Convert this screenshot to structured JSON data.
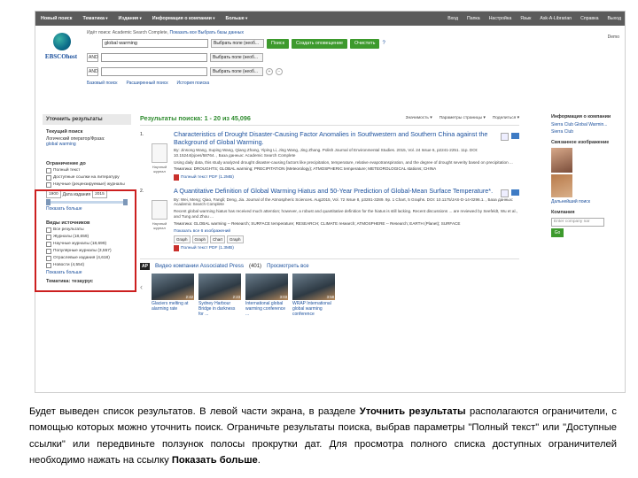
{
  "topbar": {
    "items": [
      "Новый поиск",
      "Тематика",
      "Издания",
      "Информация о компании",
      "Больше"
    ],
    "right_items": [
      "Вход",
      "Папка",
      "Настройка",
      "Язык",
      "Ask-A-Librarian",
      "Справка",
      "Выход"
    ]
  },
  "logo": {
    "text": "EBSCOhost"
  },
  "search": {
    "crumb_label": "Идёт поиск: Academic Search Complete",
    "crumb_link1": "Показать все",
    "crumb_link2": "Выбрать базы данных",
    "rows": [
      {
        "op": "",
        "value": "global warming",
        "field": "Выбрать поле (необ..."
      },
      {
        "op": "AND",
        "value": "",
        "field": "Выбрать поле (необ..."
      },
      {
        "op": "AND",
        "value": "",
        "field": "Выбрать поле (необ..."
      }
    ],
    "btn_search": "Поиск",
    "btn_alert": "Создать оповещение",
    "btn_clear": "Очистить",
    "link_basic": "Базовый поиск",
    "link_advanced": "Расширенный поиск",
    "link_history": "История поиска"
  },
  "demo": "Demo",
  "sidebar": {
    "refine_title": "Уточнить результаты",
    "current_title": "Текущий поиск",
    "bool_label": "Логический оператор/Фраза:",
    "bool_value": "global warming",
    "limit_title": "Ограничение до",
    "limits": [
      "Полный текст",
      "Доступные ссылки на литературу",
      "Научные (рецензируемые) журналы"
    ],
    "date_from": "1900",
    "date_label": "Дата издания",
    "date_to": "2015",
    "show_more": "Показать больше",
    "source_title": "Виды источников",
    "sources": [
      "Все результаты",
      "Журналы (18,659)",
      "Научные журналы (18,699)",
      "Популярные журналы (3,557)",
      "Отраслевые издания (4,618)",
      "Новости (4,554)"
    ],
    "show_more2": "Показать больше",
    "subject_title": "Тематика: тезаурус"
  },
  "results": {
    "header": "Результаты поиска: 1 - 20 из 45,096",
    "sort": "Значимость ▾",
    "page_opts": "Параметры страницы ▾",
    "share": "Поделиться ▾",
    "items": [
      {
        "num": "1.",
        "title": "Characteristics of Drought Disaster-Causing Factor Anomalies in Southwestern and Southern China against the Background of Global Warming.",
        "meta": "By: Jinsong Wang, Suping Wang, Qiang Zhang, Yiping Li, Jing Wang, Jing Zhang. Polish Journal of Environmental Studies. 2015, Vol. 24 Issue 6, p2241-2251. 11p. DOI: 10.15244/pjoes/58764. , База данных: Academic Search Complete",
        "abstract": "Using daily data, this study analyzed drought disaster-causing factors like precipitation, temperature, relative evapotranspiration, and the degree of drought severity based on precipitation ...",
        "subjects": "Тематика: DROUGHTS; GLOBAL warming; PRECIPITATION (Meteorology); ATMOSPHERIC temperature; METEOROLOGICAL stations; CHINA",
        "thumb_label": "Научный журнал",
        "pdf": "Полный текст PDF (1.2MB)"
      },
      {
        "num": "2.",
        "title": "A Quantitative Definition of Global Warming Hiatus and 50-Year Prediction of Global-Mean Surface Temperature*.",
        "meta": "By: Wei, Meng; Qiao, Fangli; Deng, Jia. Journal of the Atmospheric Sciences. Aug2015, Vol. 72 Issue 8, p3281-3289. 9p. 1 Chart, 5 Graphs. DOI: 10.1175/JAS-D-14-0296.1. , База данных: Academic Search Complete",
        "abstract": "Recent global warming hiatus has received much attention; however, a robust and quantitative definition for the hiatus is still lacking. Recent discussions ... are reviewed by Seefeldt, Wu et al., and Tung and Zhou ...",
        "subjects": "Тематика: GLOBAL warming -- Research; SURFACE temperature; RESEARCH; CLIMATE research; ATMOSPHERE -- Research; EARTH (Planet); SURFACE",
        "thumb_label": "Научный журнал",
        "images_label": "Показать все 6 изображений",
        "images": [
          "Graph",
          "Graph",
          "Chart",
          "Graph"
        ],
        "pdf": "Полный текст PDF (1.3MB)"
      }
    ]
  },
  "video": {
    "badge": "AP",
    "title": "Видео компании Associated Press",
    "count": "(401)",
    "view_all": "Просмотреть все",
    "items": [
      {
        "caption": "Glaciers melting at alarming rate",
        "duration": "2:42"
      },
      {
        "caption": "Sydney Harbour Bridge in darkness for ...",
        "duration": "2:23"
      },
      {
        "caption": "International global warming conference ...",
        "duration": "3:03"
      },
      {
        "caption": "WRAP International global warming conference",
        "duration": "3:58"
      }
    ]
  },
  "right": {
    "info_title": "Информация о компании",
    "info_links": [
      "Sierra Club Global Warmin...",
      "Sierra Club"
    ],
    "related_title": "Связанное изображение",
    "related_link": "Дальнейший поиск",
    "company_title": "Компания",
    "company_placeholder": "Enter company nar",
    "go": "Go"
  },
  "caption": {
    "p1": "Будет выведен список результатов. В левой части экрана, в разделе ",
    "b1": "Уточнить результаты",
    "p2": " располагаются ограничители, с помощью которых можно уточнить поиск. Ограничьте результаты поиска, выбрав параметры \"Полный текст\" или \"Доступные ссылки\" или передвиньте ползунок полосы прокрутки дат. Для просмотра полного списка доступных ограничителей необходимо нажать на ссылку ",
    "b2": "Показать больше",
    "p3": "."
  }
}
